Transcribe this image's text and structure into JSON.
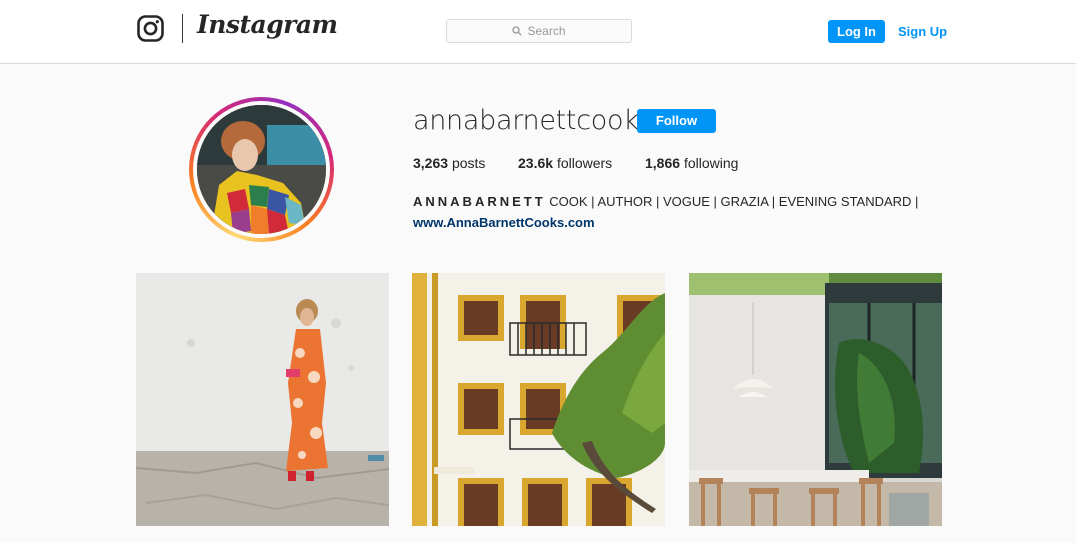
{
  "nav": {
    "wordmark": "Instagram",
    "search_placeholder": "Search",
    "login_label": "Log In",
    "signup_label": "Sign Up",
    "accent_color": "#0095f6"
  },
  "profile": {
    "username": "annabarnettcooks",
    "follow_label": "Follow",
    "stats": {
      "posts_count": "3,263",
      "posts_label": "posts",
      "followers_count": "23.6k",
      "followers_label": "followers",
      "following_count": "1,866",
      "following_label": "following"
    },
    "bio": {
      "name": "ANNABARNETT",
      "text": " COOK | AUTHOR | VOGUE | GRAZIA | EVENING STANDARD |",
      "link": "www.AnnaBarnettCooks.com"
    },
    "avatar_icon": "profile-photo"
  },
  "posts": [
    {
      "subject": "woman in orange dress"
    },
    {
      "subject": "white building with yellow windows"
    },
    {
      "subject": "dining room with plants"
    }
  ]
}
